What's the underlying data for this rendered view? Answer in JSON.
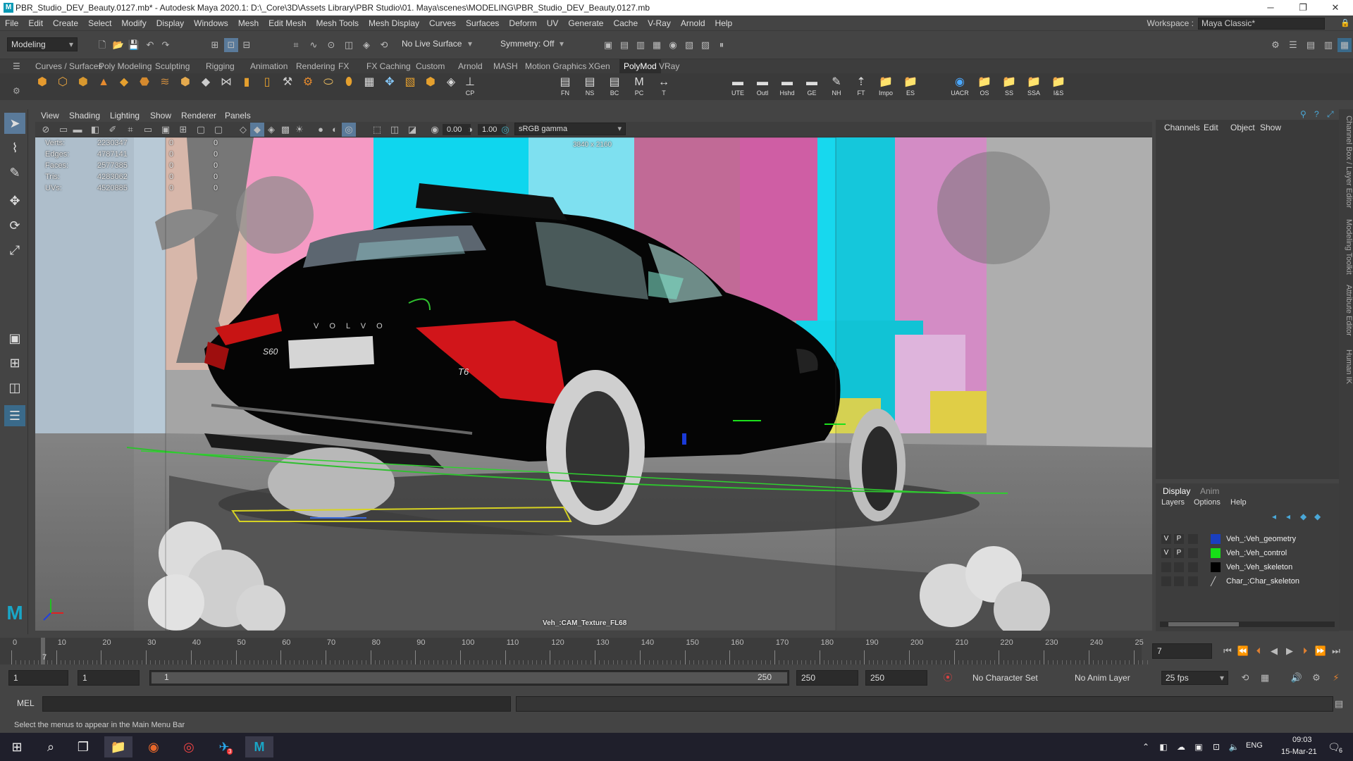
{
  "window": {
    "title": "PBR_Studio_DEV_Beauty.0127.mb* - Autodesk Maya 2020.1: D:\\_Core\\3D\\Assets Library\\PBR Studio\\01. Maya\\scenes\\MODELING\\PBR_Studio_DEV_Beauty.0127.mb",
    "app_icon": "M"
  },
  "menubar": [
    "File",
    "Edit",
    "Create",
    "Select",
    "Modify",
    "Display",
    "Windows",
    "Mesh",
    "Edit Mesh",
    "Mesh Tools",
    "Mesh Display",
    "Curves",
    "Surfaces",
    "Deform",
    "UV",
    "Generate",
    "Cache",
    "V-Ray",
    "Arnold",
    "Help"
  ],
  "workspace": {
    "label": "Workspace :",
    "value": "Maya Classic*"
  },
  "statusline": {
    "menuset": "Modeling",
    "live_surface": "No Live Surface",
    "symmetry": "Symmetry: Off"
  },
  "shelf_tabs": [
    "Curves / Surfaces",
    "Poly Modeling",
    "Sculpting",
    "Rigging",
    "Animation",
    "Rendering",
    "FX",
    "FX Caching",
    "Custom",
    "Arnold",
    "MASH",
    "Motion Graphics",
    "XGen",
    "PolyMod",
    "VRay"
  ],
  "shelf_active": "PolyMod",
  "shelf_labels": [
    "FN",
    "NS",
    "BC",
    "PC",
    "UTE",
    "Outl",
    "Hshd",
    "GE",
    "NH",
    "FT",
    "Impo",
    "ES",
    "UACR",
    "OS",
    "SS",
    "SSA",
    "I&S",
    "CP",
    "T"
  ],
  "panel_menu": [
    "View",
    "Shading",
    "Lighting",
    "Show",
    "Renderer",
    "Panels"
  ],
  "panel_toolbar": {
    "exposure": "0.00",
    "gamma": "1.00",
    "colorspace": "sRGB gamma"
  },
  "hud": {
    "labels": [
      "Verts:",
      "Edges:",
      "Faces:",
      "Tris:",
      "UVs:"
    ],
    "values": [
      "2230347",
      "4787141",
      "2577385",
      "4283062",
      "4520885"
    ],
    "col2": [
      "0",
      "0",
      "0",
      "0",
      "0"
    ],
    "col3": [
      "0",
      "0",
      "0",
      "0",
      "0"
    ],
    "resolution": "3840 x 2160",
    "camera": "Veh_:CAM_Texture_FL68"
  },
  "car_badges": {
    "brand": "V O L V O",
    "model": "S60",
    "trim": "T6"
  },
  "channel_box": {
    "tabs": [
      "Channels",
      "Edit",
      "Object",
      "Show"
    ]
  },
  "layer_editor": {
    "tabs": [
      "Display",
      "Anim"
    ],
    "menus": [
      "Layers",
      "Options",
      "Help"
    ],
    "layers": [
      {
        "v": "V",
        "p": "P",
        "color": "#1a3fbf",
        "name": "Veh_:Veh_geometry"
      },
      {
        "v": "V",
        "p": "P",
        "color": "#17e017",
        "name": "Veh_:Veh_control"
      },
      {
        "v": "",
        "p": "",
        "color": "#000000",
        "name": "Veh_:Veh_skeleton"
      },
      {
        "v": "",
        "p": "",
        "color": "",
        "name": "Char_:Char_skeleton"
      }
    ]
  },
  "side_tabs": [
    "Channel Box / Layer Editor",
    "Modeling Toolkit",
    "Attribute Editor",
    "Human IK"
  ],
  "timeline": {
    "ticks": [
      "0",
      "10",
      "20",
      "30",
      "40",
      "50",
      "60",
      "70",
      "80",
      "90",
      "100",
      "110",
      "120",
      "130",
      "140",
      "150",
      "160",
      "170",
      "180",
      "190",
      "200",
      "210",
      "220",
      "230",
      "240",
      "25"
    ],
    "current": "7",
    "current_field": "7"
  },
  "range": {
    "start": "1",
    "start2": "1",
    "slider_left": "1",
    "slider_right": "250",
    "end": "250",
    "end2": "250",
    "character_set": "No Character Set",
    "anim_layer": "No Anim Layer",
    "fps": "25 fps"
  },
  "mel": {
    "label": "MEL"
  },
  "helpline": "Select the menus to appear in the Main Menu Bar",
  "taskbar": {
    "time": "09:03",
    "date": "15-Mar-21",
    "lang": "ENG",
    "notif": "6",
    "chat_badge": "3"
  }
}
